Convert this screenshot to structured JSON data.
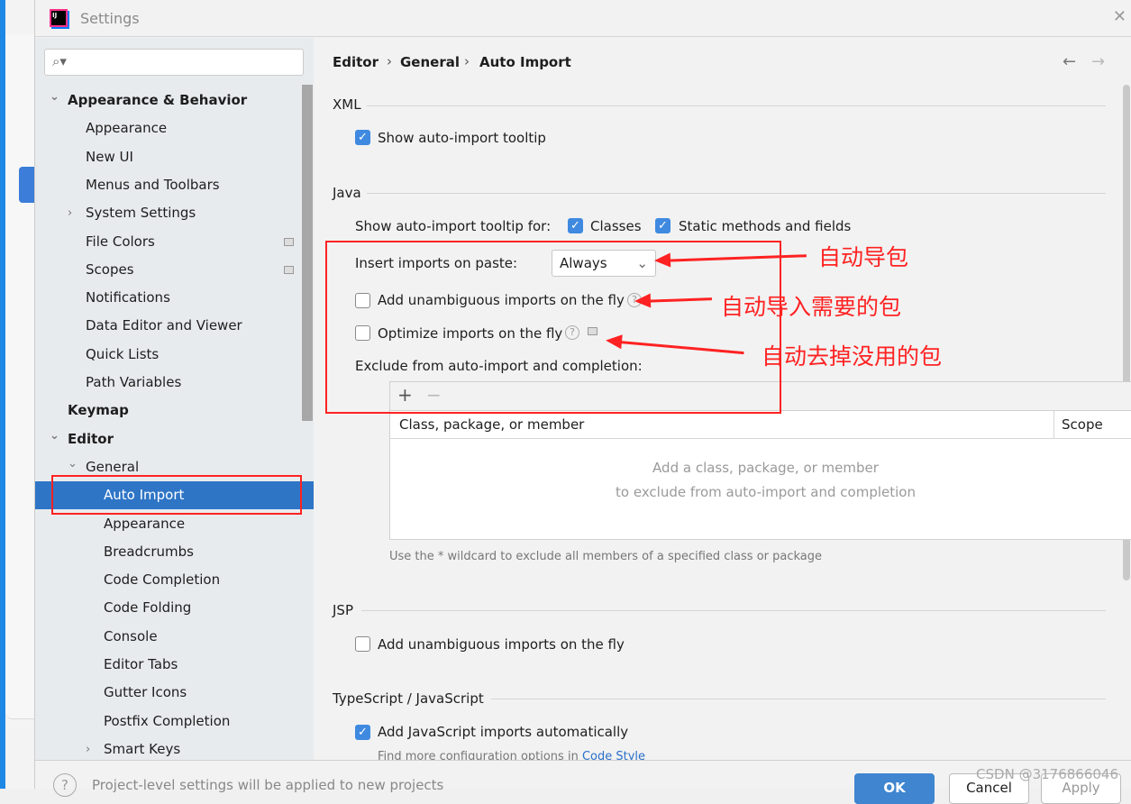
{
  "window": {
    "title": "Settings",
    "logo_text": "IJ"
  },
  "search": {
    "placeholder": ""
  },
  "tree": [
    {
      "label": "Appearance & Behavior",
      "level": 0,
      "bold": true,
      "expanded": true
    },
    {
      "label": "Appearance",
      "level": 1
    },
    {
      "label": "New UI",
      "level": 1
    },
    {
      "label": "Menus and Toolbars",
      "level": 1
    },
    {
      "label": "System Settings",
      "level": 1,
      "collapsed": true
    },
    {
      "label": "File Colors",
      "level": 1,
      "badge": true
    },
    {
      "label": "Scopes",
      "level": 1,
      "badge": true
    },
    {
      "label": "Notifications",
      "level": 1
    },
    {
      "label": "Data Editor and Viewer",
      "level": 1
    },
    {
      "label": "Quick Lists",
      "level": 1
    },
    {
      "label": "Path Variables",
      "level": 1
    },
    {
      "label": "Keymap",
      "level": 0,
      "bold": true
    },
    {
      "label": "Editor",
      "level": 0,
      "bold": true,
      "expanded": true
    },
    {
      "label": "General",
      "level": 1,
      "expanded": true
    },
    {
      "label": "Auto Import",
      "level": 2,
      "selected": true
    },
    {
      "label": "Appearance",
      "level": 2
    },
    {
      "label": "Breadcrumbs",
      "level": 2
    },
    {
      "label": "Code Completion",
      "level": 2
    },
    {
      "label": "Code Folding",
      "level": 2
    },
    {
      "label": "Console",
      "level": 2
    },
    {
      "label": "Editor Tabs",
      "level": 2
    },
    {
      "label": "Gutter Icons",
      "level": 2
    },
    {
      "label": "Postfix Completion",
      "level": 2
    },
    {
      "label": "Smart Keys",
      "level": 2,
      "collapsed": true
    }
  ],
  "breadcrumb": [
    "Editor",
    "General",
    "Auto Import"
  ],
  "nav": {
    "back": "←",
    "forward": "→"
  },
  "xml": {
    "title": "XML",
    "show_tooltip": {
      "label": "Show auto-import tooltip",
      "checked": true
    }
  },
  "java": {
    "title": "Java",
    "tooltip_for": "Show auto-import tooltip for:",
    "classes": {
      "label": "Classes",
      "checked": true
    },
    "static": {
      "label": "Static methods and fields",
      "checked": true
    },
    "insert_label": "Insert imports on paste:",
    "insert_value": "Always",
    "unambiguous": {
      "label": "Add unambiguous imports on the fly",
      "checked": false
    },
    "optimize": {
      "label": "Optimize imports on the fly",
      "checked": false
    },
    "exclude_label": "Exclude from auto-import and completion:",
    "add": "+",
    "remove": "−",
    "columns": [
      "Class, package, or member",
      "Scope"
    ],
    "empty1": "Add a class, package, or member",
    "empty2": "to exclude from auto-import and completion",
    "note": "Use the * wildcard to exclude all members of a specified class or package"
  },
  "jsp": {
    "title": "JSP",
    "unambiguous": {
      "label": "Add unambiguous imports on the fly",
      "checked": false
    }
  },
  "ts": {
    "title": "TypeScript / JavaScript",
    "add_js": {
      "label": "Add JavaScript imports automatically",
      "checked": true
    },
    "more": "Find more configuration options in",
    "link": "Code Style"
  },
  "footer": {
    "help": "?",
    "text": "Project-level settings will be applied to new projects",
    "ok": "OK",
    "cancel": "Cancel",
    "apply": "Apply"
  },
  "annotations": [
    "自动导包",
    "自动导入需要的包",
    "自动去掉没用的包"
  ],
  "watermark": "CSDN @3176866046",
  "colors": {
    "accent": "#2e75c6",
    "annotation": "#ff2222",
    "checkbox": "#3f8ae0"
  }
}
